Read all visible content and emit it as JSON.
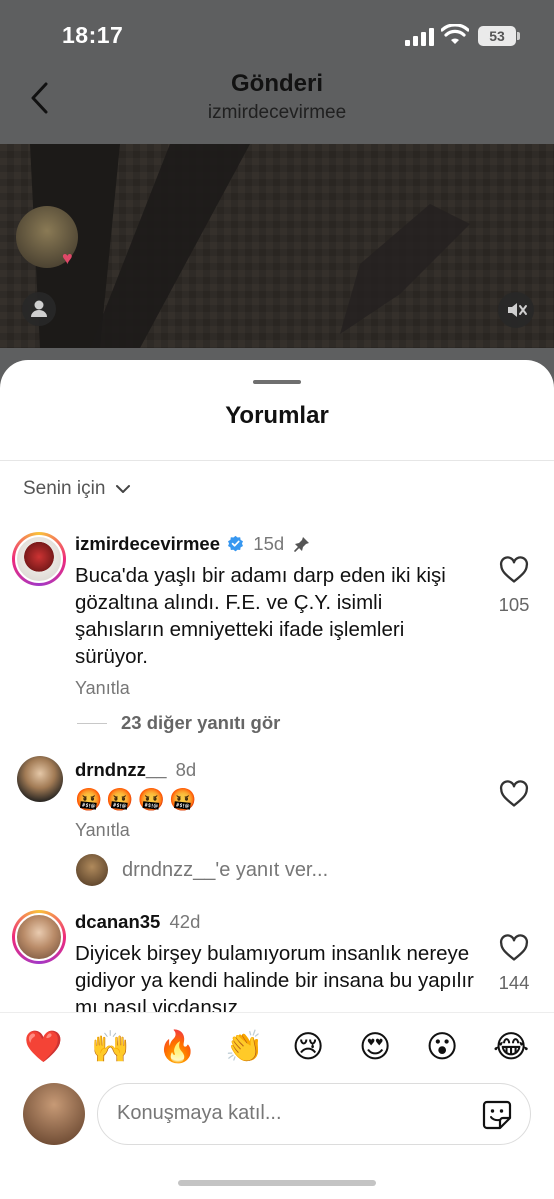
{
  "status": {
    "time": "18:17",
    "battery": "53"
  },
  "header": {
    "title": "Gönderi",
    "username": "izmirdecevirmee"
  },
  "sheet": {
    "title": "Yorumlar",
    "sort_label": "Senin için"
  },
  "comments": [
    {
      "username": "izmirdecevirmee",
      "age": "15d",
      "text": "Buca'da yaşlı bir adamı darp eden iki kişi gözaltına alındı. F.E. ve Ç.Y. isimli şahısların emniyetteki ifade işlemleri sürüyor.",
      "reply_label": "Yanıtla",
      "likes": "105",
      "view_replies": "23 diğer yanıtı gör"
    },
    {
      "username": "drndnzz__",
      "age": "8d",
      "text": "🤬🤬🤬🤬",
      "reply_label": "Yanıtla",
      "reply_prompt": "drndnzz__'e yanıt ver..."
    },
    {
      "username": "dcanan35",
      "age": "42d",
      "text": "Diyicek birşey bulamıyorum insanlık nereye gidiyor ya kendi halinde bir insana bu yapılır mı nasıl vicdansız",
      "likes": "144"
    }
  ],
  "reactions": [
    "❤️",
    "🙌",
    "🔥",
    "👏",
    "😢",
    "😍",
    "😮",
    "😂"
  ],
  "composer": {
    "placeholder": "Konuşmaya katıl..."
  },
  "colors": {
    "verified": "#3797f0",
    "ring": "#ee2a7b",
    "heart": "#e0245e"
  }
}
